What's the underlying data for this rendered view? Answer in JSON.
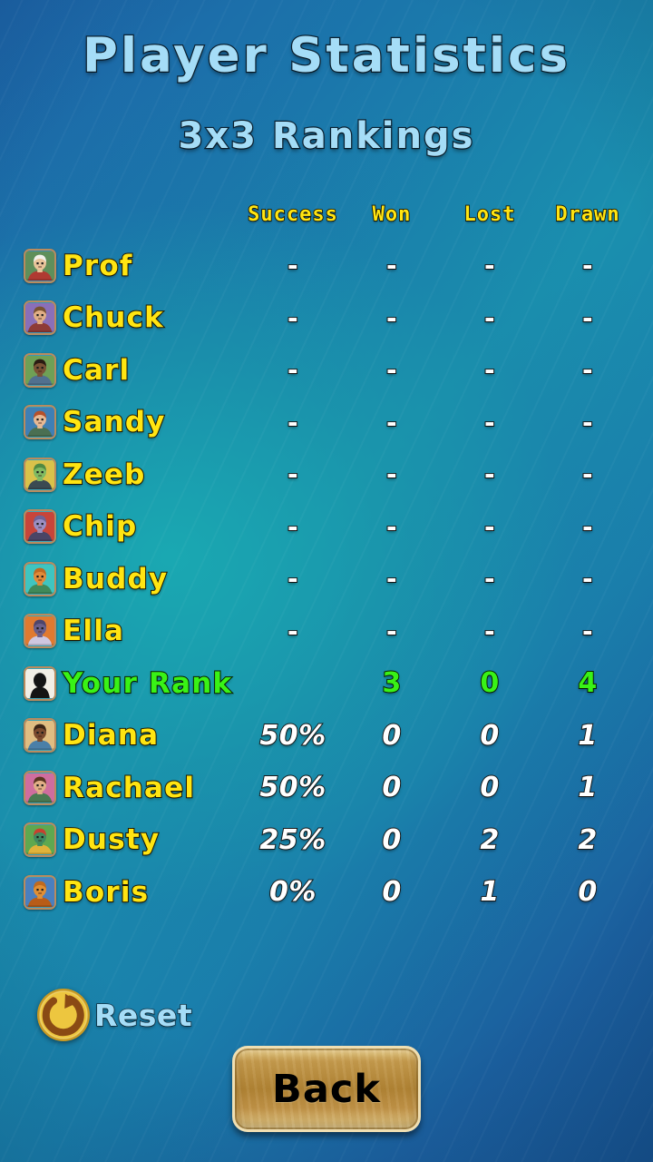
{
  "header": {
    "title": "Player Statistics",
    "subtitle": "3x3 Rankings"
  },
  "table": {
    "columns": [
      "Success",
      "Won",
      "Lost",
      "Drawn"
    ],
    "rows": [
      {
        "name": "Prof",
        "success": "-",
        "won": "-",
        "lost": "-",
        "drawn": "-",
        "avatar": "prof-avatar",
        "highlight": false
      },
      {
        "name": "Chuck",
        "success": "-",
        "won": "-",
        "lost": "-",
        "drawn": "-",
        "avatar": "chuck-avatar",
        "highlight": false
      },
      {
        "name": "Carl",
        "success": "-",
        "won": "-",
        "lost": "-",
        "drawn": "-",
        "avatar": "carl-avatar",
        "highlight": false
      },
      {
        "name": "Sandy",
        "success": "-",
        "won": "-",
        "lost": "-",
        "drawn": "-",
        "avatar": "sandy-avatar",
        "highlight": false
      },
      {
        "name": "Zeeb",
        "success": "-",
        "won": "-",
        "lost": "-",
        "drawn": "-",
        "avatar": "zeeb-avatar",
        "highlight": false
      },
      {
        "name": "Chip",
        "success": "-",
        "won": "-",
        "lost": "-",
        "drawn": "-",
        "avatar": "chip-avatar",
        "highlight": false
      },
      {
        "name": "Buddy",
        "success": "-",
        "won": "-",
        "lost": "-",
        "drawn": "-",
        "avatar": "buddy-avatar",
        "highlight": false
      },
      {
        "name": "Ella",
        "success": "-",
        "won": "-",
        "lost": "-",
        "drawn": "-",
        "avatar": "ella-avatar",
        "highlight": false
      },
      {
        "name": "Your Rank",
        "success": "",
        "won": "3",
        "lost": "0",
        "drawn": "4",
        "avatar": "your-rank-avatar",
        "highlight": true
      },
      {
        "name": "Diana",
        "success": "50%",
        "won": "0",
        "lost": "0",
        "drawn": "1",
        "avatar": "diana-avatar",
        "highlight": false
      },
      {
        "name": "Rachael",
        "success": "50%",
        "won": "0",
        "lost": "0",
        "drawn": "1",
        "avatar": "rachael-avatar",
        "highlight": false
      },
      {
        "name": "Dusty",
        "success": "25%",
        "won": "0",
        "lost": "2",
        "drawn": "2",
        "avatar": "dusty-avatar",
        "highlight": false
      },
      {
        "name": "Boris",
        "success": "0%",
        "won": "0",
        "lost": "1",
        "drawn": "0",
        "avatar": "boris-avatar",
        "highlight": false
      }
    ]
  },
  "reset": {
    "label": "Reset",
    "icon": "refresh-icon"
  },
  "back": {
    "label": "Back"
  },
  "colors": {
    "title_text": "#a5ddf7",
    "header_text": "#ffe512",
    "player_name": "#ffe512",
    "your_rank": "#39f216",
    "value_text": "#ffffff",
    "background_teal": "#1a9aaa",
    "background_blue": "#1d64a8",
    "button_gold": "#b08334"
  },
  "avatar_palettes": {
    "prof-avatar": {
      "bg": "#5f8f5a",
      "skin": "#e8c49a",
      "hair": "#f2f0ea",
      "cloth": "#b03a32"
    },
    "chuck-avatar": {
      "bg": "#8a6fb8",
      "skin": "#dfae86",
      "hair": "#7a5230",
      "cloth": "#8e3b36"
    },
    "carl-avatar": {
      "bg": "#6fa055",
      "skin": "#7a5235",
      "hair": "#2a1b12",
      "cloth": "#51708f"
    },
    "sandy-avatar": {
      "bg": "#3f7fb5",
      "skin": "#e6b894",
      "hair": "#b5502a",
      "cloth": "#4a6f52"
    },
    "zeeb-avatar": {
      "bg": "#d9c24a",
      "skin": "#7fba62",
      "hair": "#4f8a42",
      "cloth": "#3a4a52"
    },
    "chip-avatar": {
      "bg": "#c8453a",
      "skin": "#9b8fc2",
      "hair": "#6f6396",
      "cloth": "#4a4566"
    },
    "buddy-avatar": {
      "bg": "#3fc5c0",
      "skin": "#e08a3a",
      "hair": "#c06a22",
      "cloth": "#3f8a5a"
    },
    "ella-avatar": {
      "bg": "#e07a30",
      "skin": "#6a5f8a",
      "hair": "#4e456b",
      "cloth": "#cfc7e0"
    },
    "your-rank-avatar": {
      "bg": "#f2efe6",
      "skin": "#141414",
      "hair": "#141414",
      "cloth": "#141414"
    },
    "diana-avatar": {
      "bg": "#e0bd82",
      "skin": "#7a4a2e",
      "hair": "#3b2416",
      "cloth": "#4a7fa8"
    },
    "rachael-avatar": {
      "bg": "#cf6d9e",
      "skin": "#e0ae86",
      "hair": "#5a3520",
      "cloth": "#4a7a52"
    },
    "dusty-avatar": {
      "bg": "#5fa84f",
      "skin": "#3f8a5f",
      "hair": "#c8402f",
      "cloth": "#e0b33a"
    },
    "boris-avatar": {
      "bg": "#4a7fbf",
      "skin": "#e08f34",
      "hair": "#c06a1e",
      "cloth": "#b85c18"
    }
  }
}
